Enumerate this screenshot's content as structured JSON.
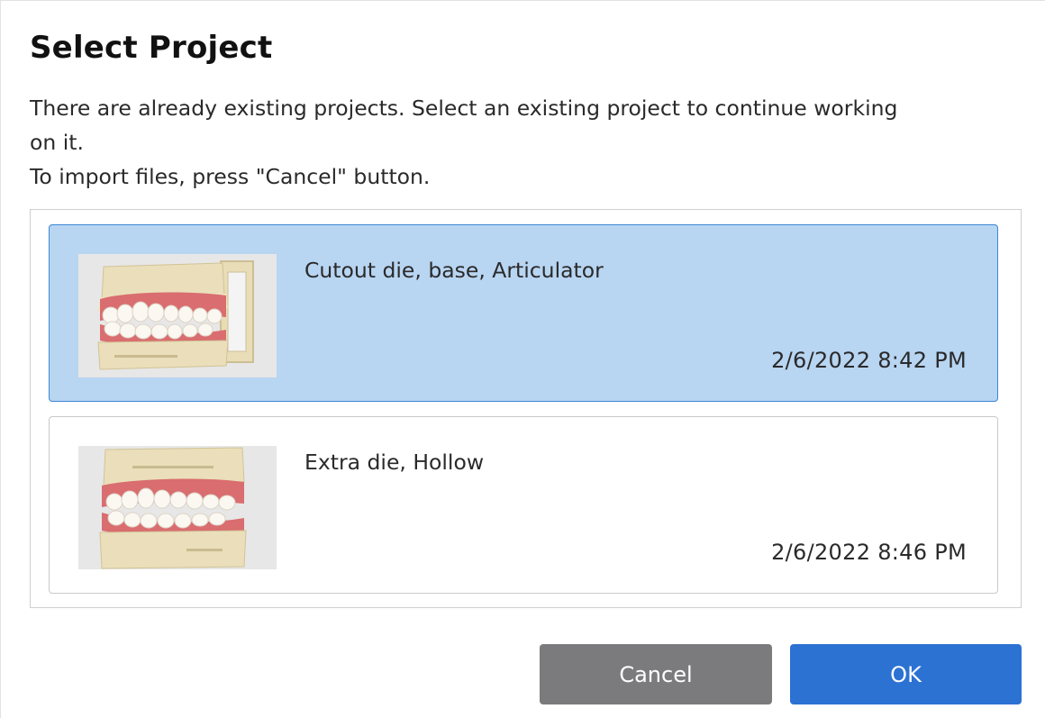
{
  "dialog": {
    "title": "Select Project",
    "message_lines": [
      "There are already existing projects. Select an existing project to continue working",
      "on it.",
      "To import files, press \"Cancel\" button."
    ]
  },
  "projects": [
    {
      "name": "Cutout die, base, Articulator",
      "date": "2/6/2022 8:42 PM",
      "selected": true,
      "thumbnail": "dental-model-articulator-image"
    },
    {
      "name": "Extra die, Hollow",
      "date": "2/6/2022 8:46 PM",
      "selected": false,
      "thumbnail": "dental-model-hollow-image"
    }
  ],
  "buttons": {
    "cancel_label": "Cancel",
    "ok_label": "OK"
  },
  "colors": {
    "selected_background": "#b8d5f2",
    "selected_border": "#3d86d6",
    "ok_button": "#2b72d3",
    "cancel_button": "#7b7b7e"
  }
}
